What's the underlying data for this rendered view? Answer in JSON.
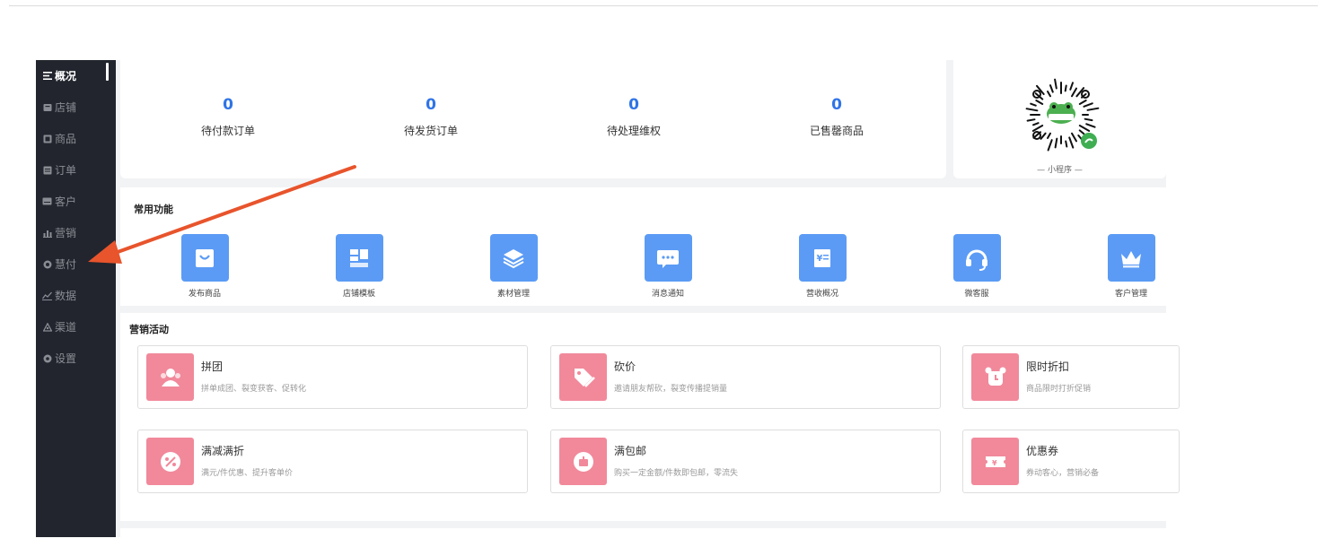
{
  "sidebar": {
    "items": [
      {
        "label": "概况",
        "icon": "menu-lines-icon",
        "active": true
      },
      {
        "label": "店铺",
        "icon": "store-icon"
      },
      {
        "label": "商品",
        "icon": "product-icon"
      },
      {
        "label": "订单",
        "icon": "order-icon"
      },
      {
        "label": "客户",
        "icon": "customer-icon"
      },
      {
        "label": "营销",
        "icon": "bar-chart-icon"
      },
      {
        "label": "慧付",
        "icon": "pay-icon"
      },
      {
        "label": "数据",
        "icon": "line-chart-icon"
      },
      {
        "label": "渠道",
        "icon": "channel-icon"
      },
      {
        "label": "设置",
        "icon": "gear-icon"
      }
    ]
  },
  "stats": [
    {
      "value": "0",
      "label": "待付款订单"
    },
    {
      "value": "0",
      "label": "待发货订单"
    },
    {
      "value": "0",
      "label": "待处理维权"
    },
    {
      "value": "0",
      "label": "已售罄商品"
    }
  ],
  "qr": {
    "caption": "— 小程序 —"
  },
  "common_functions": {
    "title": "常用功能",
    "items": [
      {
        "label": "发布商品",
        "icon": "shopping-bag-icon",
        "color": "#5b9bf5"
      },
      {
        "label": "店铺模板",
        "icon": "layout-template-icon",
        "color": "#5b9bf5"
      },
      {
        "label": "素材管理",
        "icon": "layers-icon",
        "color": "#5b9bf5"
      },
      {
        "label": "消息通知",
        "icon": "message-icon",
        "color": "#5b9bf5"
      },
      {
        "label": "营收概况",
        "icon": "revenue-icon",
        "color": "#5b9bf5"
      },
      {
        "label": "微客服",
        "icon": "headset-icon",
        "color": "#5b9bf5"
      },
      {
        "label": "客户管理",
        "icon": "crown-icon",
        "color": "#5b9bf5"
      }
    ]
  },
  "marketing": {
    "title": "营销活动",
    "accent": "#f1899b",
    "items": [
      {
        "title": "拼团",
        "desc": "拼单成团、裂变获客、促转化",
        "icon": "group-buy-icon"
      },
      {
        "title": "砍价",
        "desc": "邀请朋友帮砍，裂变传播提销量",
        "icon": "bargain-tag-icon"
      },
      {
        "title": "限时折扣",
        "desc": "商品限时打折促销",
        "icon": "alarm-clock-icon"
      },
      {
        "title": "满减满折",
        "desc": "满元/件优惠、提升客单价",
        "icon": "percent-icon"
      },
      {
        "title": "满包邮",
        "desc": "购买一定金额/件数即包邮，零流失",
        "icon": "gift-box-icon"
      },
      {
        "title": "优惠券",
        "desc": "券动客心，营销必备",
        "icon": "coupon-icon"
      }
    ]
  },
  "colors": {
    "sidebar_bg": "#22252d",
    "stat_number": "#2f74e6",
    "annotation_arrow": "#e8542c"
  }
}
